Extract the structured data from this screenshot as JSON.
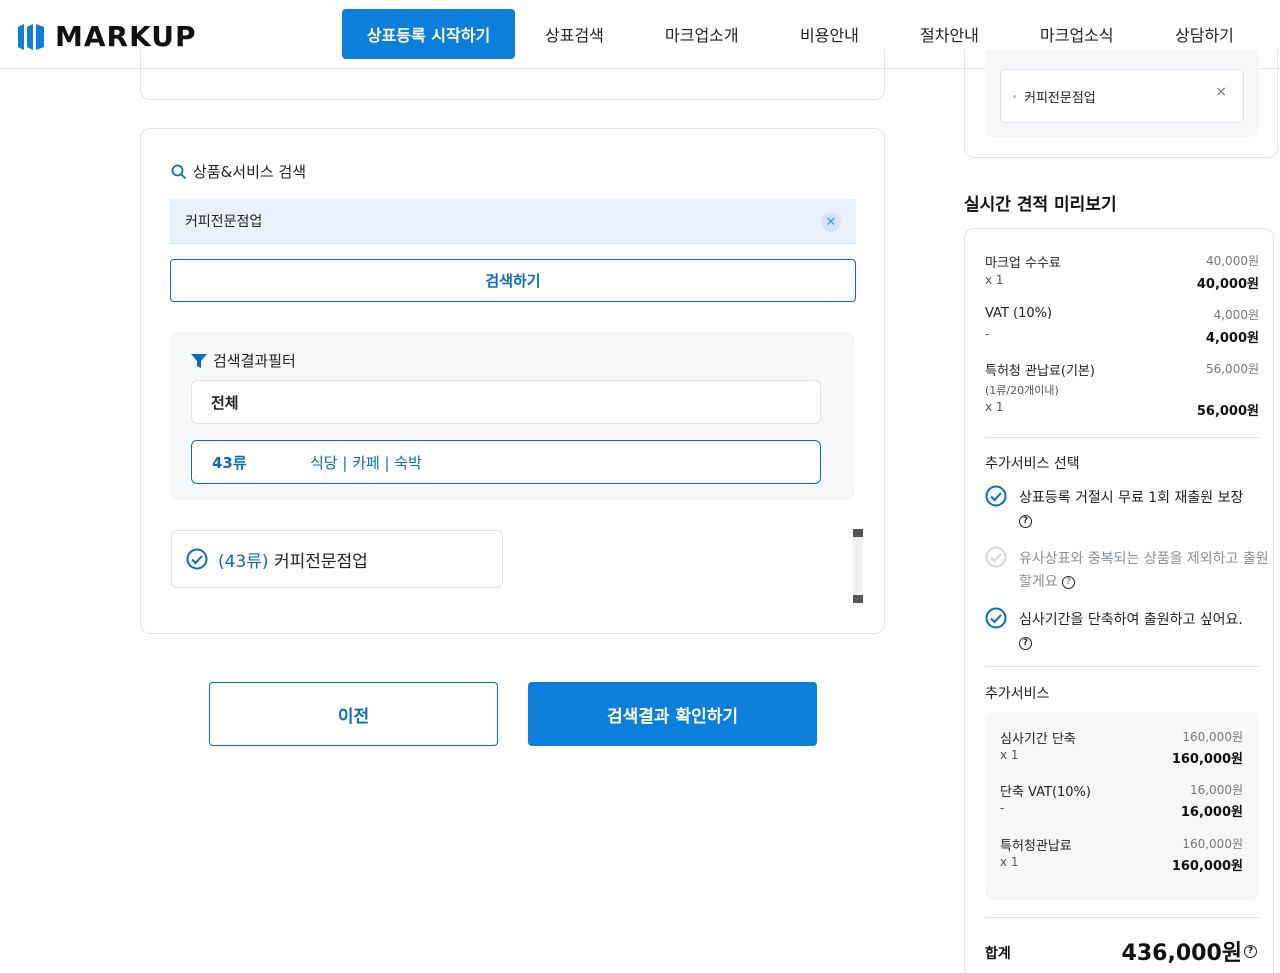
{
  "header": {
    "logo_text": "MARKUP",
    "nav": {
      "cta": "상표등록 시작하기",
      "items": [
        "상표검색",
        "마크업소개",
        "비용안내",
        "절차안내",
        "마크업소식",
        "상담하기"
      ]
    }
  },
  "search_section": {
    "title": "상품&서비스 검색",
    "query": "커피전문점업",
    "search_button": "검색하기"
  },
  "filter": {
    "title": "검색결과필터",
    "all_label": "전체",
    "selected": {
      "class": "43류",
      "description": "식당 | 카페 | 숙박"
    }
  },
  "result": {
    "class": "(43류)",
    "name": "커피전문점업"
  },
  "buttons": {
    "prev": "이전",
    "next": "검색결과 확인하기"
  },
  "right_top": {
    "chip": "커피전문점업",
    "close": "×"
  },
  "quote": {
    "title": "실시간 견적 미리보기",
    "fees": [
      {
        "name": "마크업 수수료",
        "unit": "40,000원",
        "qty": "x 1",
        "total": "40,000원"
      },
      {
        "name": "VAT (10%)",
        "unit": "4,000원",
        "qty": "-",
        "total": "4,000원"
      },
      {
        "name": "특허청 관납료(기본)",
        "sub": "(1류/20개이내)",
        "unit": "56,000원",
        "qty": "x 1",
        "total": "56,000원"
      }
    ],
    "options_title": "추가서비스 선택",
    "options": [
      {
        "label": "상표등록 거절시 무료 1회 재출원 보장",
        "help": "?",
        "checked": true
      },
      {
        "label": "유사상표와 중복되는 상품을 제외하고 출원할게요",
        "help": "?",
        "checked": false
      },
      {
        "label": "심사기간을 단축하여 출원하고 싶어요.",
        "help": "?",
        "checked": true
      }
    ],
    "extra_title": "추가서비스",
    "extras": [
      {
        "name": "심사기간 단축",
        "unit": "160,000원",
        "qty": "x 1",
        "total": "160,000원"
      },
      {
        "name": "단축 VAT(10%)",
        "unit": "16,000원",
        "qty": "-",
        "total": "16,000원"
      },
      {
        "name": "특허청관납료",
        "unit": "160,000원",
        "qty": "x 1",
        "total": "160,000원"
      }
    ],
    "sum_label": "합계",
    "sum_value": "436,000원",
    "sum_help": "?"
  },
  "colors": {
    "primary": "#0b7fd9",
    "primary_dark": "#0b6cbf",
    "search_bg": "#eaf1fc"
  }
}
